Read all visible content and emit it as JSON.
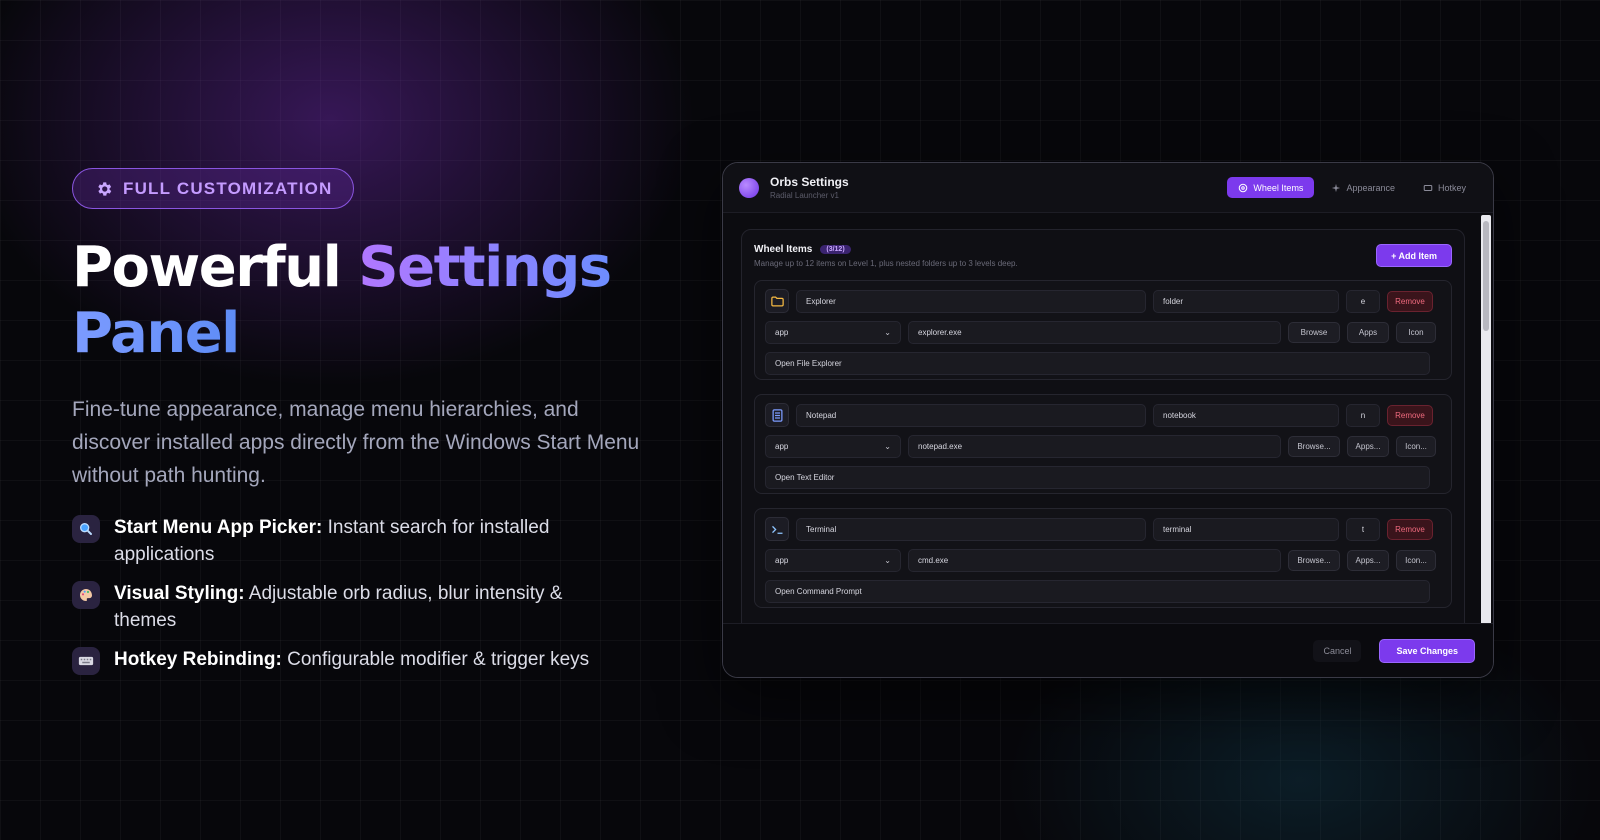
{
  "hero": {
    "badge": "FULL CUSTOMIZATION",
    "headline_white": "Powerful",
    "headline_gradient": "Settings",
    "headline_line2": "Panel",
    "lede": "Fine-tune appearance, manage menu hierarchies, and discover installed apps directly from the Windows Start Menu without path hunting.",
    "features": [
      {
        "title": "Start Menu App Picker:",
        "text": " Instant search for installed applications",
        "icon": "search-icon"
      },
      {
        "title": "Visual Styling:",
        "text": " Adjustable orb radius, blur intensity & themes",
        "icon": "palette-icon"
      },
      {
        "title": "Hotkey Rebinding:",
        "text": " Configurable modifier & trigger keys",
        "icon": "keyboard-icon"
      }
    ]
  },
  "window": {
    "title": "Orbs Settings",
    "subtitle": "Radial Launcher v1",
    "tabs": [
      {
        "label": "Wheel Items",
        "active": true
      },
      {
        "label": "Appearance",
        "active": false
      },
      {
        "label": "Hotkey",
        "active": false
      }
    ],
    "section": {
      "title": "Wheel Items",
      "count": "(3/12)",
      "description": "Manage up to 12 items on Level 1, plus nested folders up to 3 levels deep.",
      "add_label": "+ Add Item"
    },
    "items": [
      {
        "name": "Explorer",
        "id": "folder",
        "key": "e",
        "type": "app",
        "path": "explorer.exe",
        "description": "Open File Explorer",
        "icon": "folder-icon",
        "browse": "Browse",
        "apps": "Apps",
        "icon_btn": "Icon",
        "remove": "Remove"
      },
      {
        "name": "Notepad",
        "id": "notebook",
        "key": "n",
        "type": "app",
        "path": "notepad.exe",
        "description": "Open Text Editor",
        "icon": "notepad-icon",
        "browse": "Browse...",
        "apps": "Apps...",
        "icon_btn": "Icon...",
        "remove": "Remove"
      },
      {
        "name": "Terminal",
        "id": "terminal",
        "key": "t",
        "type": "app",
        "path": "cmd.exe",
        "description": "Open Command Prompt",
        "icon": "terminal-icon",
        "browse": "Browse...",
        "apps": "Apps...",
        "icon_btn": "Icon...",
        "remove": "Remove"
      }
    ],
    "footer": {
      "cancel": "Cancel",
      "save": "Save Changes"
    }
  },
  "colors": {
    "accent": "#7c3aed",
    "danger": "#f06a7e",
    "folder": "#f5b942",
    "notepad": "#7c9bff"
  }
}
